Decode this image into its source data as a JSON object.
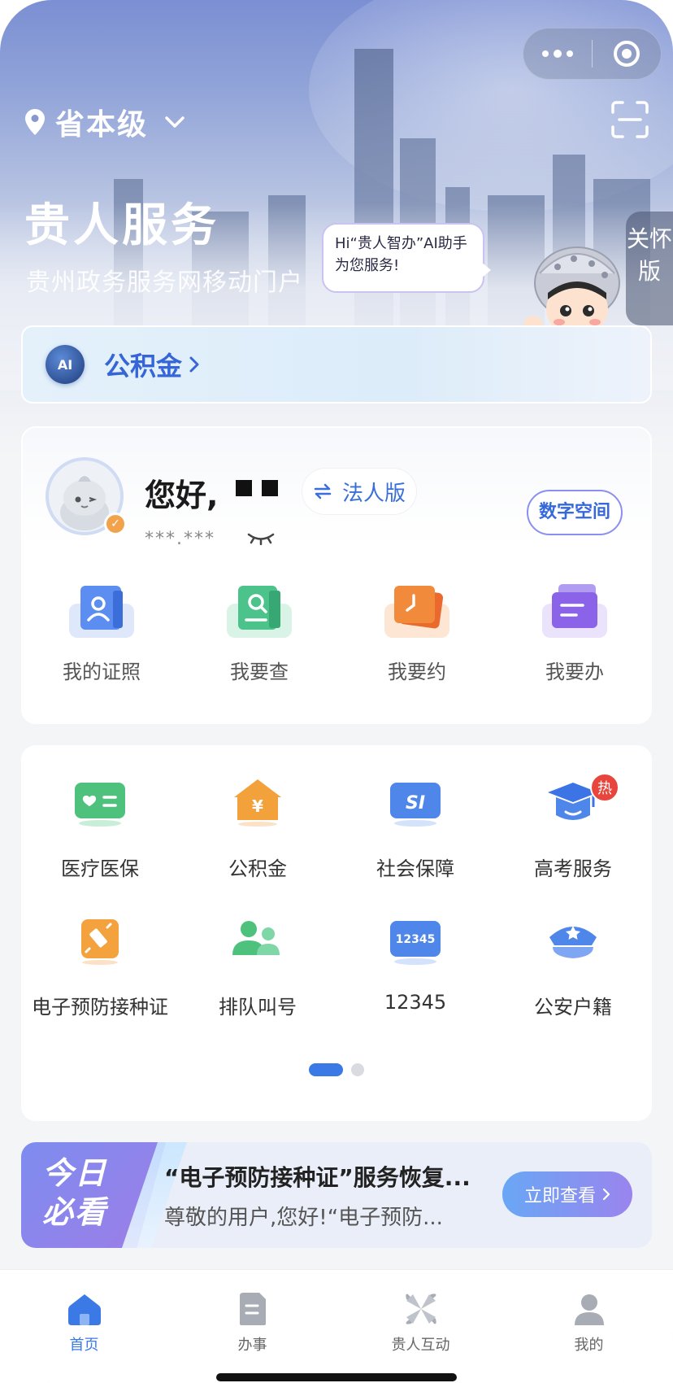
{
  "header": {
    "location": "省本级",
    "brand_title": "贵人服务",
    "brand_subtitle": "贵州政务服务网移动门户",
    "care_mode": "关怀版"
  },
  "assistant": {
    "bubble_text": "Hi“贵人智办”AI助手为您服务!",
    "ai_badge": "AI",
    "ai_topic": "公积金"
  },
  "user": {
    "greeting": "您好,",
    "masked_name": "■ ■",
    "id_masked": "***.***",
    "switch_label": "法人版",
    "digital_space": "数字空间"
  },
  "quick_actions": [
    {
      "label": "我的证照",
      "icon": "id-card-icon",
      "color": "#5b8ef0"
    },
    {
      "label": "我要查",
      "icon": "search-doc-icon",
      "color": "#4cc38a"
    },
    {
      "label": "我要约",
      "icon": "clock-icon",
      "color": "#f28a3c"
    },
    {
      "label": "我要办",
      "icon": "folder-icon",
      "color": "#8a63e8"
    }
  ],
  "services": [
    {
      "label": "医疗医保",
      "icon": "medical-card-icon"
    },
    {
      "label": "公积金",
      "icon": "house-yuan-icon"
    },
    {
      "label": "社会保障",
      "icon": "si-card-icon"
    },
    {
      "label": "高考服务",
      "icon": "graduation-cap-icon",
      "badge": "热"
    },
    {
      "label": "电子预防接种证",
      "icon": "vaccine-icon"
    },
    {
      "label": "排队叫号",
      "icon": "queue-people-icon"
    },
    {
      "label": "12345",
      "icon": "hotline-12345-icon",
      "icon_text": "12345"
    },
    {
      "label": "公安户籍",
      "icon": "police-cap-icon"
    }
  ],
  "pager": {
    "current": 1,
    "total": 2
  },
  "today": {
    "tag": "今日必看",
    "headline": "“电子预防接种证”服务恢复...",
    "desc": "尊敬的用户,您好!“电子预防...",
    "button": "立即查看"
  },
  "tabs": [
    {
      "label": "首页",
      "icon": "home-icon",
      "active": true
    },
    {
      "label": "办事",
      "icon": "document-icon",
      "active": false
    },
    {
      "label": "贵人互动",
      "icon": "pinwheel-icon",
      "active": false
    },
    {
      "label": "我的",
      "icon": "person-icon",
      "active": false
    }
  ],
  "colors": {
    "accent": "#3b7ae6",
    "hot_badge": "#e8453c"
  }
}
